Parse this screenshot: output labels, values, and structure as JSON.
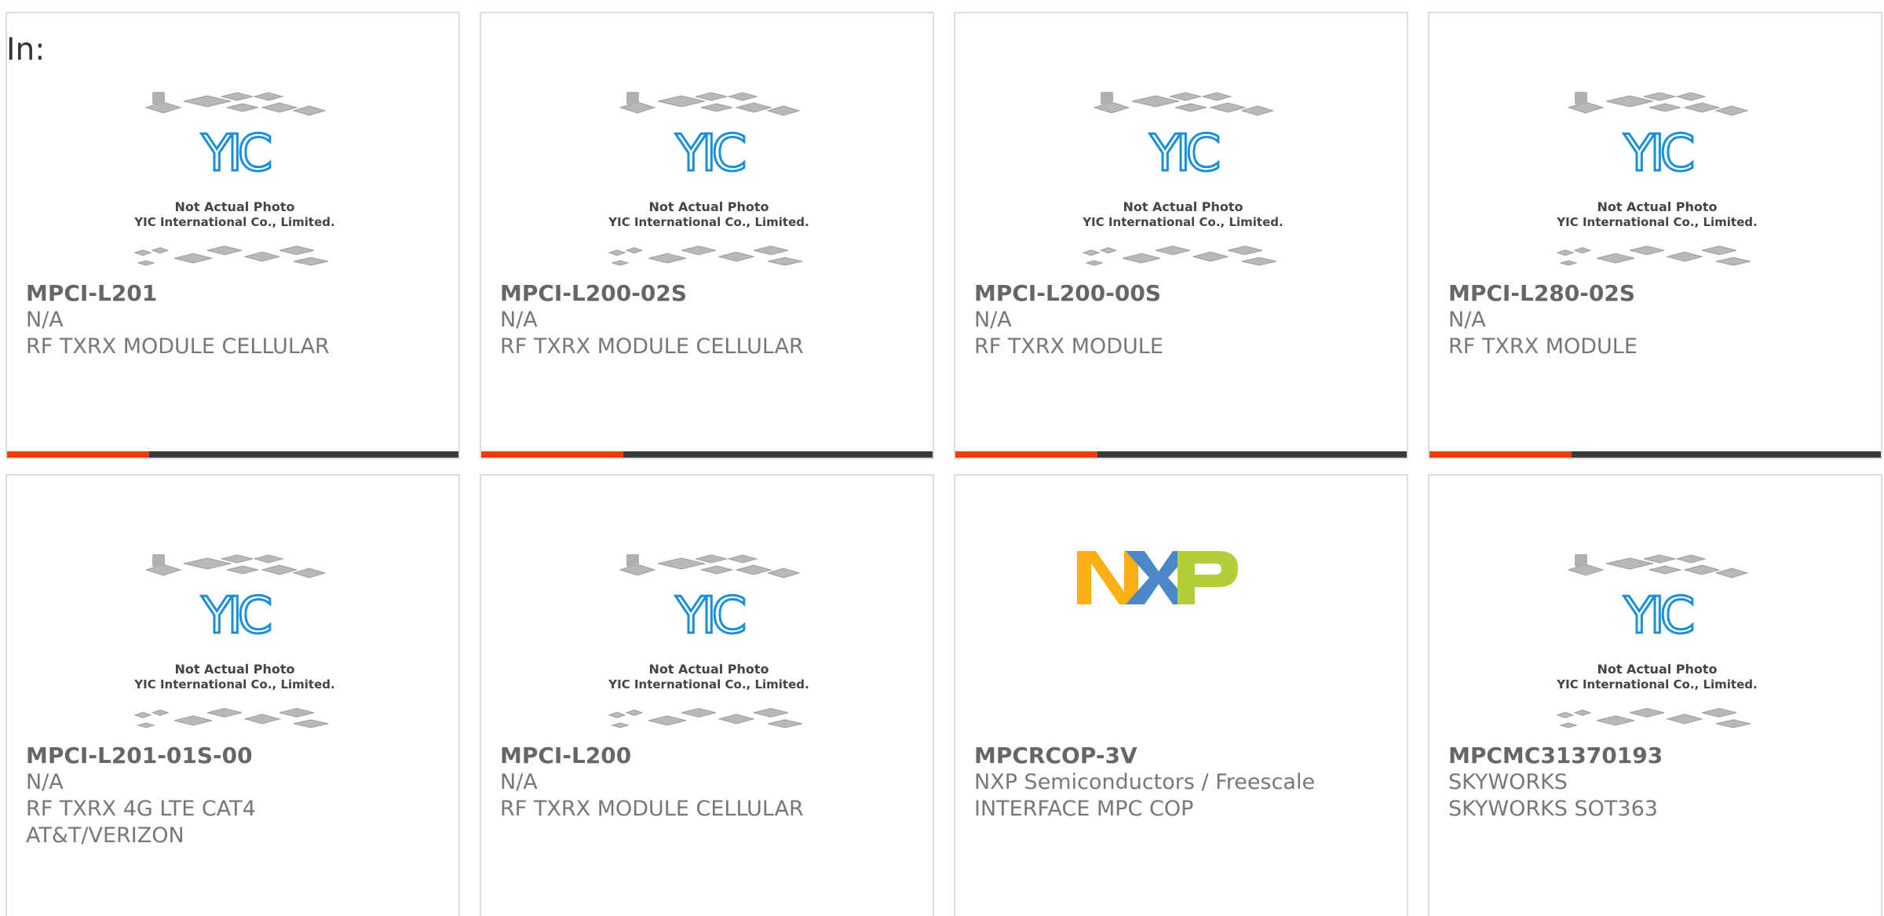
{
  "header": {
    "in_label": "In:"
  },
  "placeholder": {
    "line1": "Not Actual Photo",
    "line2": "YIC International Co., Limited.",
    "logo_text": "YIC"
  },
  "brand_logo": {
    "text": "NXP"
  },
  "colors": {
    "accent": "#e8400c",
    "bar": "#3a3a3a",
    "yic_blue": "#1a8fd6",
    "nxp_orange": "#f9b012",
    "nxp_blue": "#4a88c7",
    "nxp_green": "#b2cf3b"
  },
  "products": [
    {
      "part": "MPCI-L201",
      "mfr": "N/A",
      "desc": "RF TXRX MODULE CELLULAR",
      "desc2": "",
      "image": "placeholder"
    },
    {
      "part": "MPCI-L200-02S",
      "mfr": "N/A",
      "desc": "RF TXRX MODULE CELLULAR",
      "desc2": "",
      "image": "placeholder"
    },
    {
      "part": "MPCI-L200-00S",
      "mfr": "N/A",
      "desc": "RF TXRX MODULE",
      "desc2": "",
      "image": "placeholder"
    },
    {
      "part": "MPCI-L280-02S",
      "mfr": "N/A",
      "desc": "RF TXRX MODULE",
      "desc2": "",
      "image": "placeholder"
    },
    {
      "part": "MPCI-L201-01S-00",
      "mfr": "N/A",
      "desc": "RF TXRX 4G LTE CAT4",
      "desc2": "AT&T/VERIZON",
      "image": "placeholder"
    },
    {
      "part": "MPCI-L200",
      "mfr": "N/A",
      "desc": "RF TXRX MODULE CELLULAR",
      "desc2": "",
      "image": "placeholder"
    },
    {
      "part": "MPCRCOP-3V",
      "mfr": "NXP Semiconductors / Freescale",
      "desc": "INTERFACE MPC COP",
      "desc2": "",
      "image": "nxp"
    },
    {
      "part": "MPCMC31370193",
      "mfr": "SKYWORKS",
      "desc": "SKYWORKS SOT363",
      "desc2": "",
      "image": "placeholder"
    }
  ]
}
